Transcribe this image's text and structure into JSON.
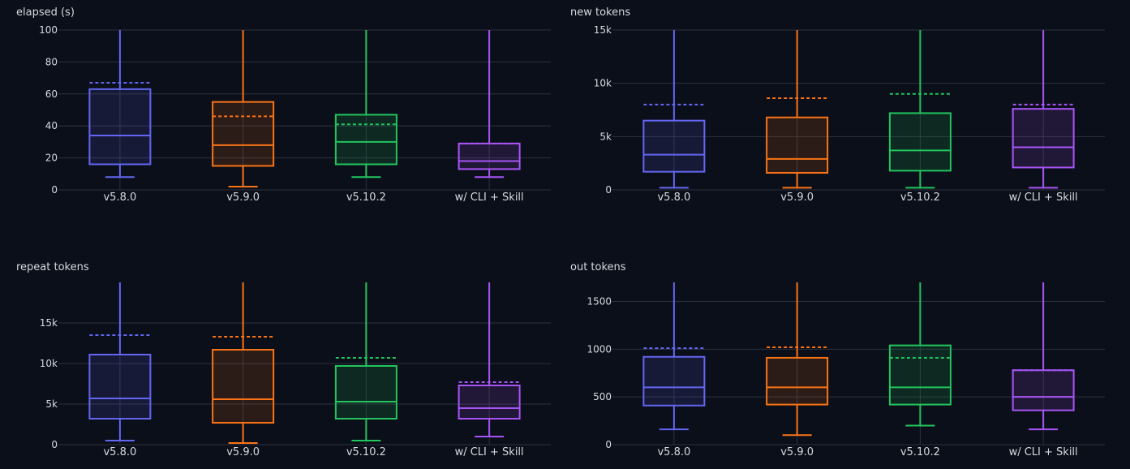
{
  "chart_data": [
    {
      "type": "box",
      "title": "elapsed (s)",
      "categories": [
        "v5.8.0",
        "v5.9.0",
        "v5.10.2",
        "w/ CLI + Skill"
      ],
      "ylim": [
        0,
        100
      ],
      "yticks": [
        0,
        20,
        40,
        60,
        80,
        100
      ],
      "ytick_labels": [
        "0",
        "20",
        "40",
        "60",
        "80",
        "100"
      ],
      "grid": true,
      "boxes": [
        {
          "min": 8,
          "q1": 16,
          "median": 34,
          "q3": 63,
          "max": 100,
          "mean": 67
        },
        {
          "min": 2,
          "q1": 15,
          "median": 28,
          "q3": 55,
          "max": 100,
          "mean": 46
        },
        {
          "min": 8,
          "q1": 16,
          "median": 30,
          "q3": 47,
          "max": 100,
          "mean": 41
        },
        {
          "min": 8,
          "q1": 13,
          "median": 18,
          "q3": 29,
          "max": 100,
          "mean": 29
        }
      ]
    },
    {
      "type": "box",
      "title": "new tokens",
      "categories": [
        "v5.8.0",
        "v5.9.0",
        "v5.10.2",
        "w/ CLI + Skill"
      ],
      "ylim": [
        0,
        15000
      ],
      "yticks": [
        0,
        5000,
        10000,
        15000
      ],
      "ytick_labels": [
        "0",
        "5k",
        "10k",
        "15k"
      ],
      "grid": true,
      "boxes": [
        {
          "min": 200,
          "q1": 1700,
          "median": 3300,
          "q3": 6500,
          "max": 15000,
          "mean": 8000
        },
        {
          "min": 200,
          "q1": 1600,
          "median": 2900,
          "q3": 6800,
          "max": 15000,
          "mean": 8600
        },
        {
          "min": 200,
          "q1": 1800,
          "median": 3700,
          "q3": 7200,
          "max": 15000,
          "mean": 9000
        },
        {
          "min": 200,
          "q1": 2100,
          "median": 4000,
          "q3": 7600,
          "max": 15000,
          "mean": 8000
        }
      ]
    },
    {
      "type": "box",
      "title": "repeat tokens",
      "categories": [
        "v5.8.0",
        "v5.9.0",
        "v5.10.2",
        "w/ CLI + Skill"
      ],
      "ylim": [
        0,
        20000
      ],
      "yticks": [
        0,
        5000,
        10000,
        15000
      ],
      "ytick_labels": [
        "0",
        "5k",
        "10k",
        "15k"
      ],
      "grid": true,
      "boxes": [
        {
          "min": 500,
          "q1": 3200,
          "median": 5700,
          "q3": 11100,
          "max": 20000,
          "mean": 13500
        },
        {
          "min": 200,
          "q1": 2700,
          "median": 5600,
          "q3": 11700,
          "max": 20000,
          "mean": 13300
        },
        {
          "min": 500,
          "q1": 3200,
          "median": 5300,
          "q3": 9700,
          "max": 20000,
          "mean": 10700
        },
        {
          "min": 1000,
          "q1": 3200,
          "median": 4500,
          "q3": 7300,
          "max": 20000,
          "mean": 7700
        }
      ]
    },
    {
      "type": "box",
      "title": "out tokens",
      "categories": [
        "v5.8.0",
        "v5.9.0",
        "v5.10.2",
        "w/ CLI + Skill"
      ],
      "ylim": [
        0,
        1700
      ],
      "yticks": [
        0,
        500,
        1000,
        1500
      ],
      "ytick_labels": [
        "0",
        "500",
        "1000",
        "1500"
      ],
      "grid": true,
      "boxes": [
        {
          "min": 160,
          "q1": 410,
          "median": 600,
          "q3": 920,
          "max": 1700,
          "mean": 1010
        },
        {
          "min": 100,
          "q1": 420,
          "median": 600,
          "q3": 910,
          "max": 1700,
          "mean": 1020
        },
        {
          "min": 200,
          "q1": 420,
          "median": 600,
          "q3": 1040,
          "max": 1700,
          "mean": 910
        },
        {
          "min": 160,
          "q1": 360,
          "median": 500,
          "q3": 780,
          "max": 1700,
          "mean": 780
        }
      ]
    }
  ],
  "colors": {
    "series": [
      "#6366f1",
      "#f97316",
      "#22c55e",
      "#a855f7"
    ],
    "grid": "#2c323f",
    "text": "#d6d9e0",
    "background": "#0b0f19"
  }
}
